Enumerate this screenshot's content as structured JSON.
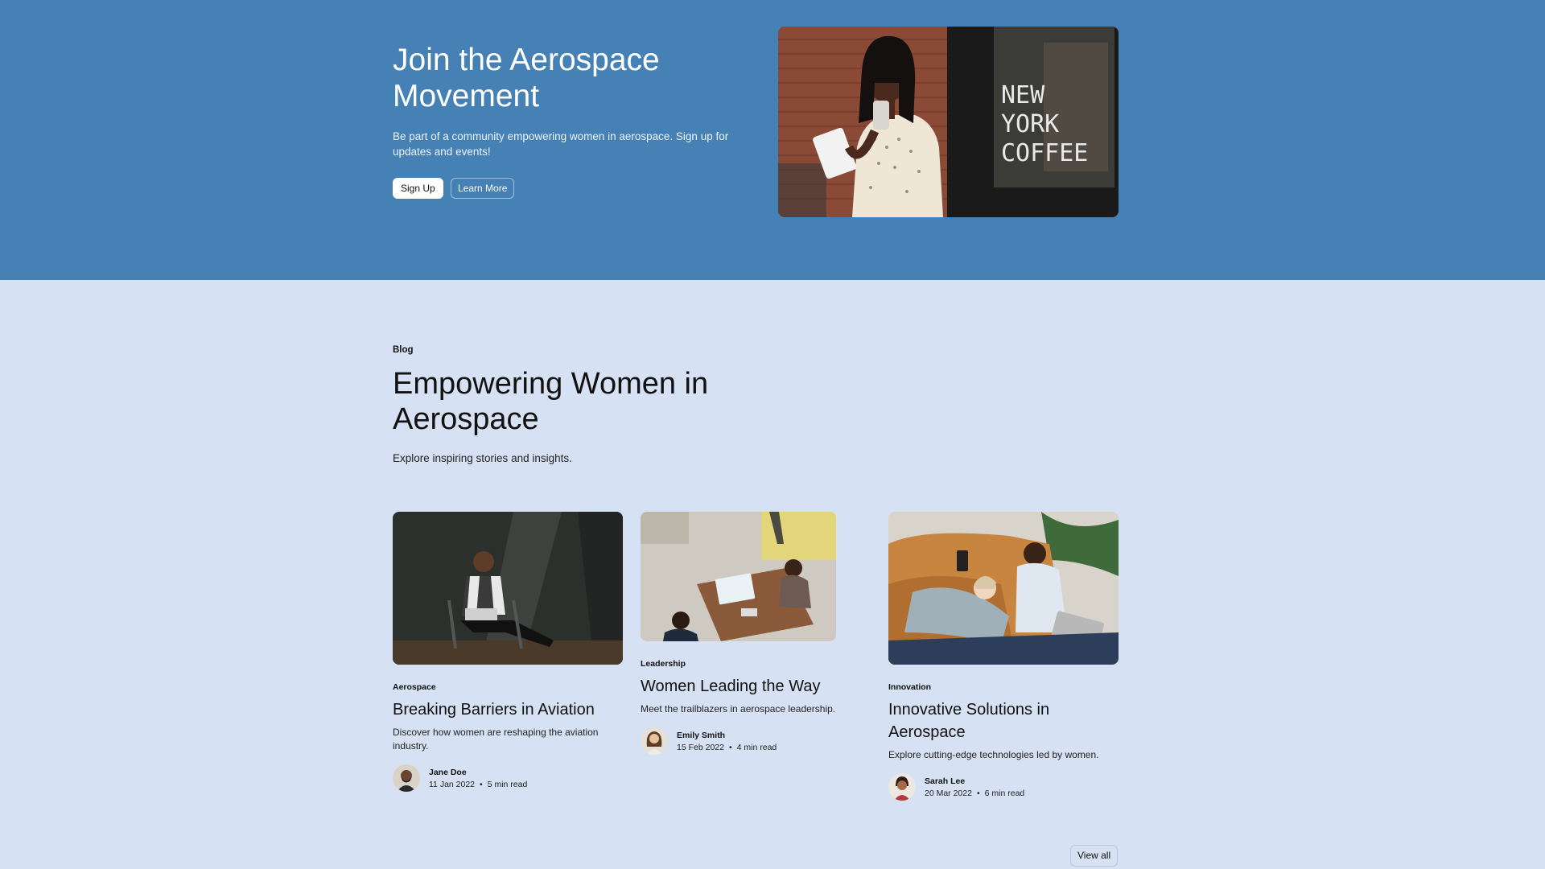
{
  "hero": {
    "title": "Join the Aerospace Movement",
    "subtitle": "Be part of a community empowering women in aerospace. Sign up for updates and events!",
    "primary_button": "Sign Up",
    "secondary_button": "Learn More",
    "image_sign_text": "NEW YORK COFFEE"
  },
  "blog": {
    "tag": "Blog",
    "title": "Empowering Women in Aerospace",
    "subtitle": "Explore inspiring stories and insights.",
    "view_all": "View all",
    "posts": [
      {
        "category": "Aerospace",
        "title": "Breaking Barriers in Aviation",
        "description": "Discover how women are reshaping the aviation industry.",
        "author": "Jane Doe",
        "date": "11 Jan 2022",
        "read_time": "5 min read"
      },
      {
        "category": "Leadership",
        "title": "Women Leading the Way",
        "description": "Meet the trailblazers in aerospace leadership.",
        "author": "Emily Smith",
        "date": "15 Feb 2022",
        "read_time": "4 min read"
      },
      {
        "category": "Innovation",
        "title": "Innovative Solutions in Aerospace",
        "description": "Explore cutting-edge technologies led by women.",
        "author": "Sarah Lee",
        "date": "20 Mar 2022",
        "read_time": "6 min read"
      }
    ]
  },
  "colors": {
    "hero_bg": "#4681b6",
    "page_bg": "#d6e1f4"
  }
}
